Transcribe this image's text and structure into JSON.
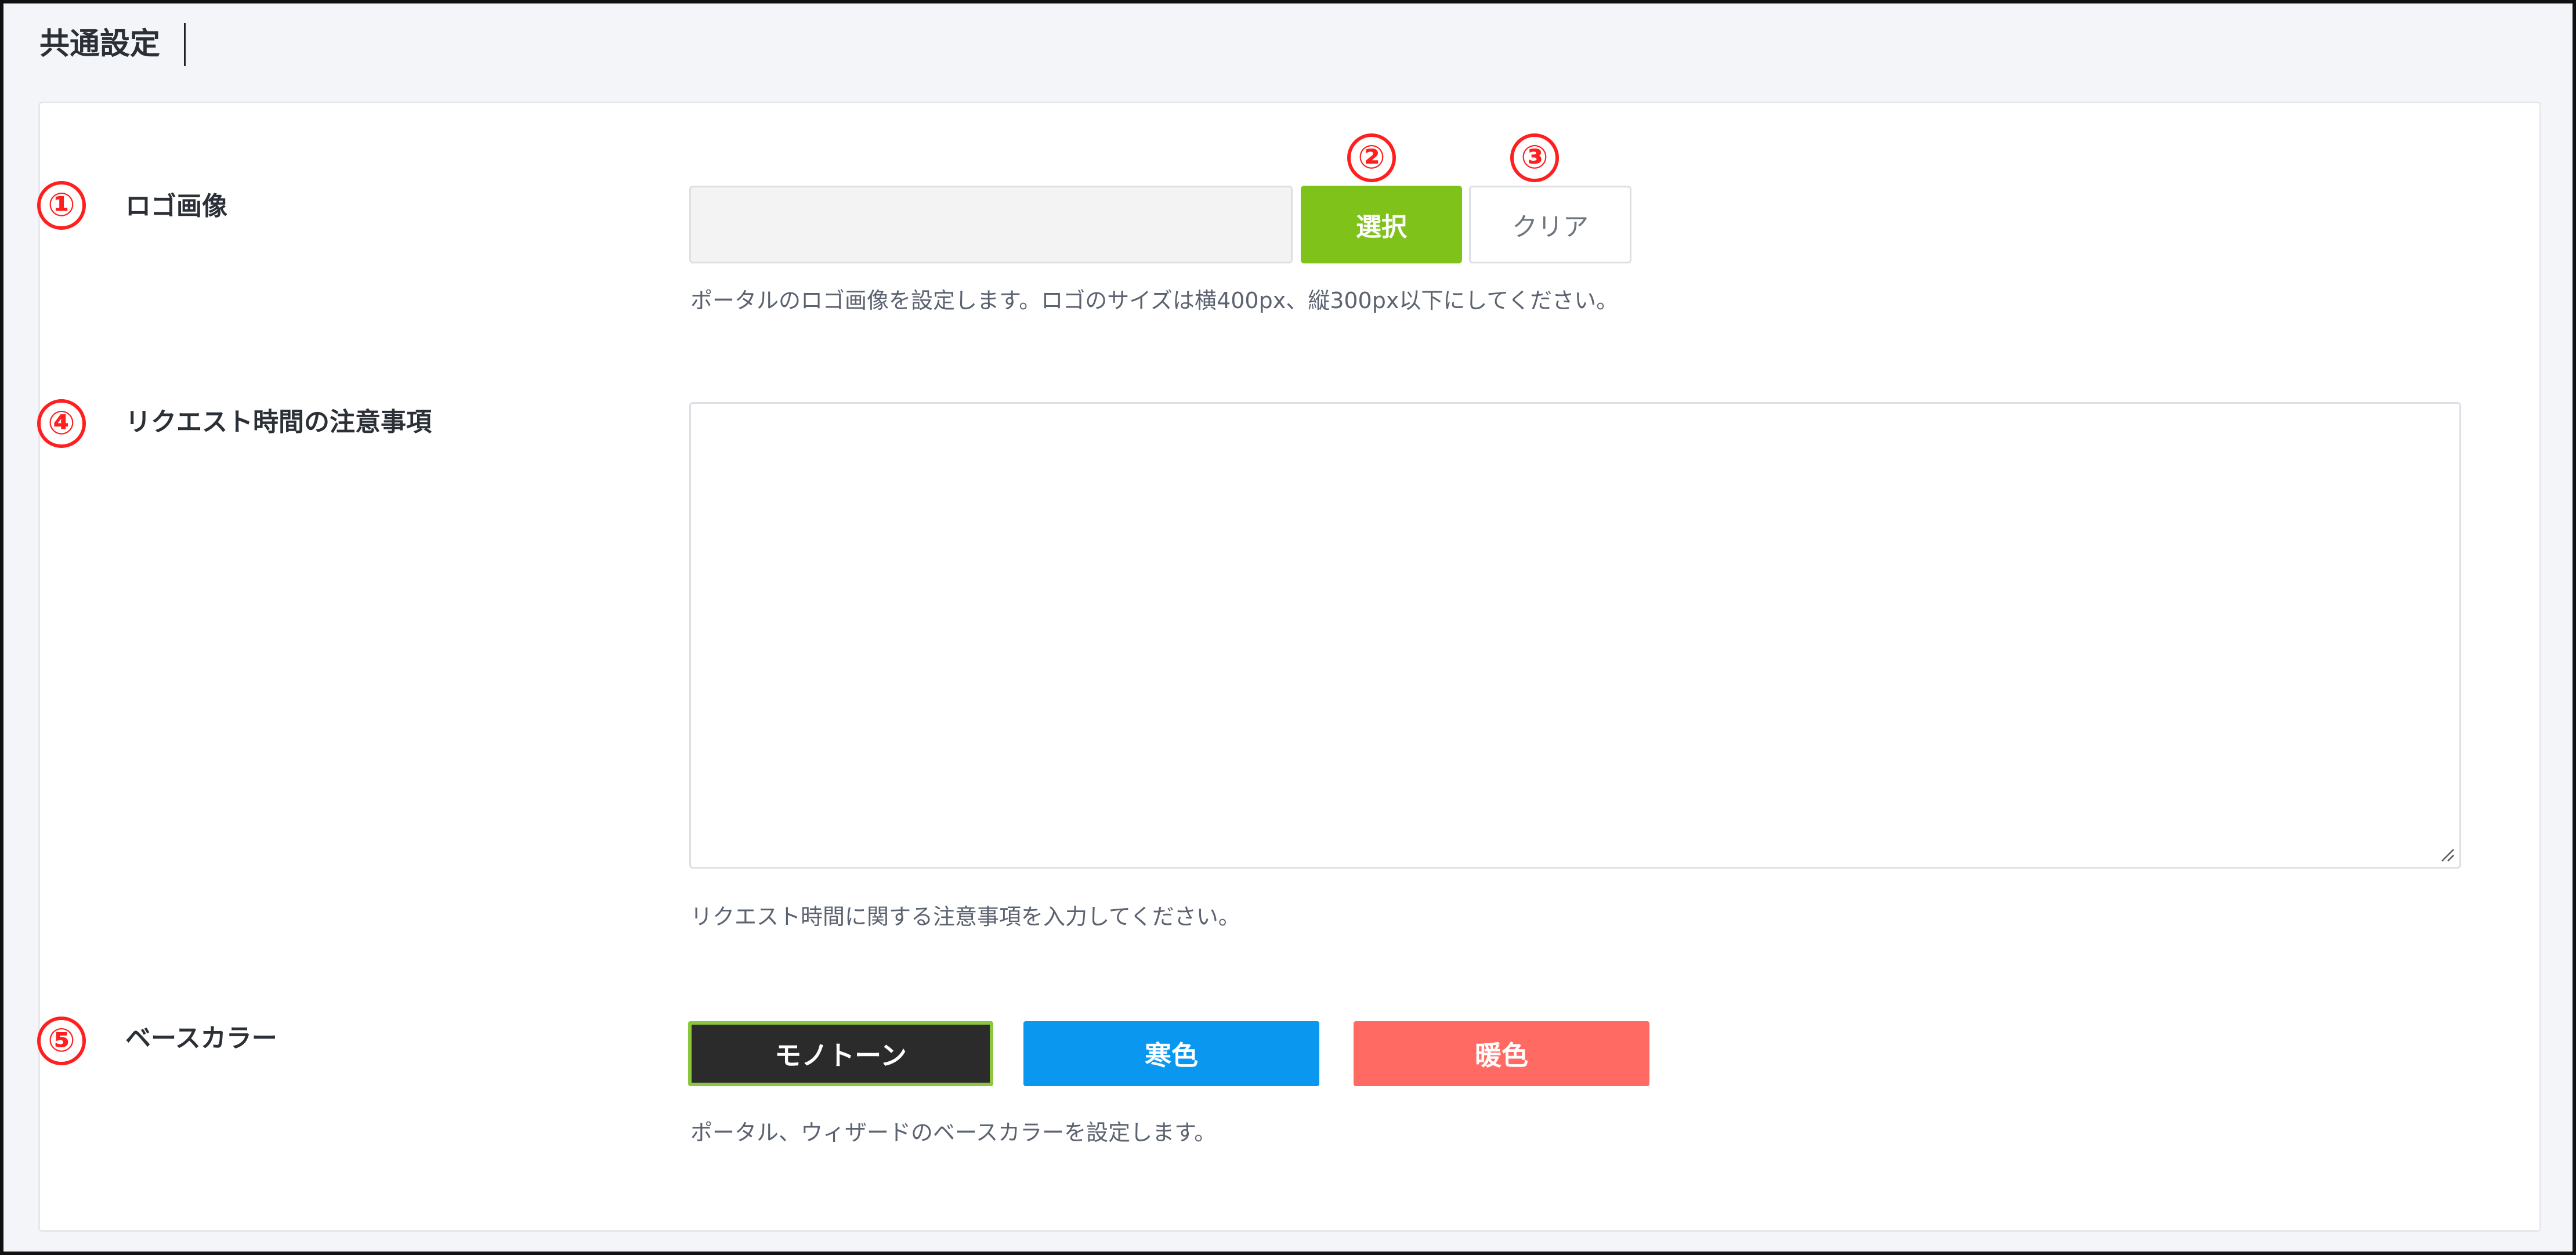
{
  "page": {
    "title": "共通設定"
  },
  "colors": {
    "accent": "#7fc21a",
    "badge": "#ff1f1f",
    "cool": "#0a97f0",
    "warm": "#ff6b62",
    "mono": "#2b2b2b"
  },
  "badges": [
    "①",
    "②",
    "③",
    "④",
    "⑤"
  ],
  "logo": {
    "label": "ロゴ画像",
    "value": "",
    "select_label": "選択",
    "clear_label": "クリア",
    "help": "ポータルのロゴ画像を設定します。ロゴのサイズは横400px、縦300px以下にしてください。"
  },
  "notice": {
    "label": "リクエスト時間の注意事項",
    "value": "",
    "help": "リクエスト時間に関する注意事項を入力してください。"
  },
  "base_color": {
    "label": "ベースカラー",
    "options": [
      "モノトーン",
      "寒色",
      "暖色"
    ],
    "selected": "モノトーン",
    "help": "ポータル、ウィザードのベースカラーを設定します。"
  }
}
